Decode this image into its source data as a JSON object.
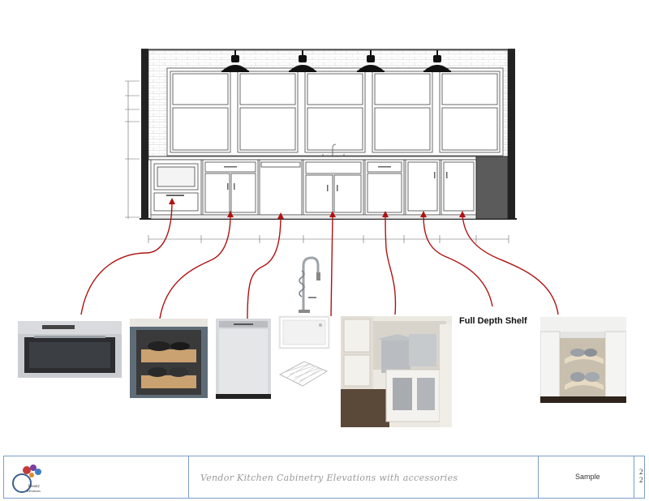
{
  "labels": {
    "full_depth_shelf": "Full Depth Shelf"
  },
  "footer": {
    "title": "Vendor Kitchen Cabinetry Elevations with accessories",
    "sample": "Sample",
    "page_top": "2",
    "page_bottom": "2"
  },
  "colors": {
    "leader_line": "#b01212",
    "footer_border": "#7b9ec9",
    "fridge_panel": "#5b5b5b"
  },
  "accessories": [
    {
      "name": "microwave-drawer-photo",
      "icon": "microwave-drawer"
    },
    {
      "name": "pull-out-shelves-photo",
      "icon": "pull-out-cookware-shelves"
    },
    {
      "name": "dishwasher-photo",
      "icon": "dishwasher"
    },
    {
      "name": "faucet-photo",
      "icon": "pull-down-faucet"
    },
    {
      "name": "farmhouse-sink-photo",
      "icon": "farmhouse-sink"
    },
    {
      "name": "sink-grid-photo",
      "icon": "sink-bottom-grid"
    },
    {
      "name": "trash-pullout-photo",
      "icon": "double-trash-pullout"
    },
    {
      "name": "lazy-susan-photo",
      "icon": "corner-lazy-susan"
    }
  ]
}
